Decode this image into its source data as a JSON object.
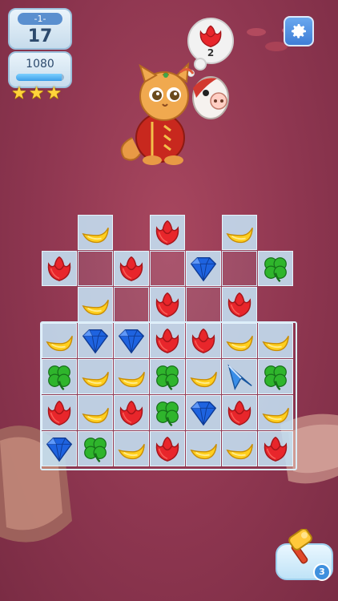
{
  "hud": {
    "level_label": "-1-",
    "moves": "17",
    "score": "1080",
    "score_progress": 0.95,
    "stars_earned": 3
  },
  "goal": {
    "piece": "rose",
    "count": "2"
  },
  "settings_icon": "gear-icon",
  "board": {
    "rows": [
      [
        null,
        "moon",
        null,
        "rose",
        null,
        "moon",
        null
      ],
      [
        "rose",
        "empty",
        "rose",
        "empty",
        "diamond",
        "empty",
        "clover"
      ],
      [
        null,
        "moon",
        "empty",
        "rose",
        "empty",
        "rose",
        null
      ],
      [
        "moon",
        "diamond",
        "diamond",
        "rose",
        "rose",
        "moon",
        "moon"
      ],
      [
        "clover",
        "moon",
        "moon",
        "clover",
        "moon",
        "plane",
        "clover"
      ],
      [
        "rose",
        "moon",
        "rose",
        "clover",
        "diamond",
        "rose",
        "moon"
      ],
      [
        "diamond",
        "clover",
        "moon",
        "rose",
        "moon",
        "moon",
        "rose"
      ]
    ]
  },
  "booster": {
    "icon": "hammer-icon",
    "count": "3"
  },
  "colors": {
    "rose": "#e8262b",
    "moon": "#ffcf1f",
    "diamond": "#1e63e0",
    "clover": "#2fb52c",
    "plane": "#3a8ee8"
  }
}
